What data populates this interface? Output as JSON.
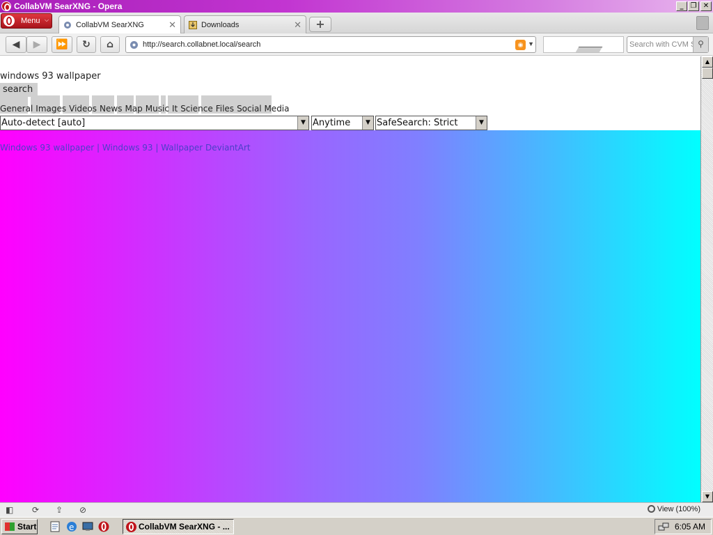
{
  "window": {
    "title": "CollabVM SearXNG - Opera",
    "minimize": "_",
    "restore": "❐",
    "close": "✕"
  },
  "tabbar": {
    "menu_label": "Menu",
    "menu_caret": "⌵",
    "tabs": [
      {
        "label": "CollabVM SearXNG",
        "close": "✕",
        "active": true
      },
      {
        "label": "Downloads",
        "close": "✕",
        "active": false
      }
    ],
    "new_tab": "+"
  },
  "navbar": {
    "back": "◀",
    "forward": "▶",
    "fast_forward": "⏩",
    "reload": "↻",
    "home": "⌂",
    "url": "http://search.collabnet.local/search",
    "rss": "◉",
    "url_dropdown": "▼",
    "search_placeholder": "Search with CVM SearXNG",
    "search_go": "⚲"
  },
  "page": {
    "query": "windows 93 wallpaper",
    "search_button": "search",
    "categories": [
      "General",
      "Images",
      "Videos",
      "News",
      "Map",
      "Music",
      "It",
      "Science",
      "Files",
      "Social Media"
    ],
    "language_select": "Auto-detect [auto]",
    "time_select": "Anytime",
    "safesearch_select": "SafeSearch: Strict",
    "select_arrow": "▼",
    "overlapping_results_text": "Windows 93 wallpaper | Windows 93 | Wallpaper DeviantArt",
    "gradient_colors": [
      "#ff00ff",
      "#9966ff",
      "#7f80ff",
      "#00ffff"
    ]
  },
  "scrollbar": {
    "up": "▲",
    "down": "▼"
  },
  "statusbar": {
    "panel_toggle": "◧",
    "sync": "⟳",
    "share": "⇪",
    "speed": "⊘",
    "zoom_label": "View (100%)"
  },
  "taskbar": {
    "start_label": "Start",
    "task_label": "CollabVM SearXNG - ...",
    "time": "6:05 AM"
  }
}
